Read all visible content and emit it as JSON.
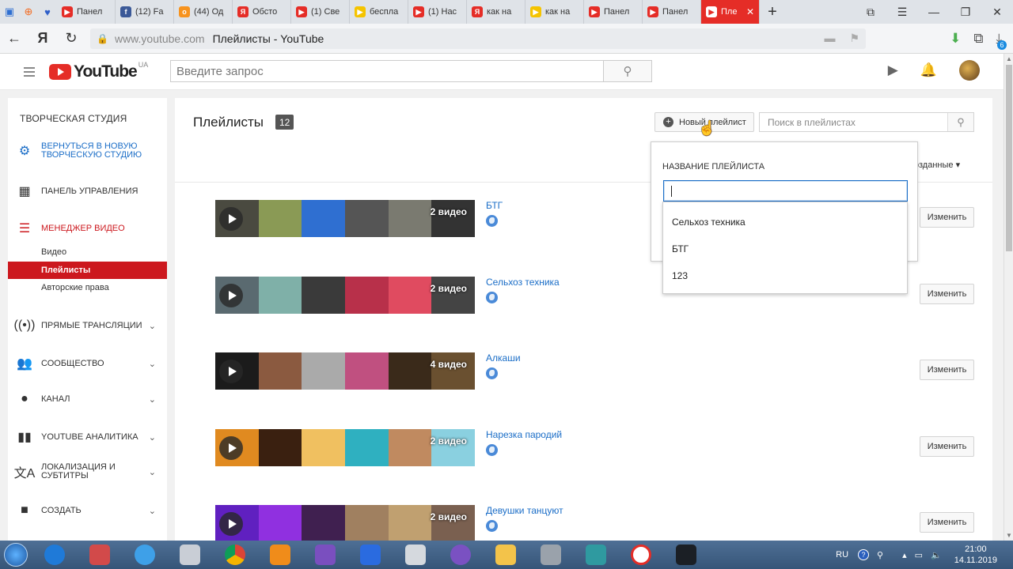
{
  "browser": {
    "tabs": [
      {
        "label": "",
        "icon": "pin-icon",
        "color": "#2f6fd1"
      },
      {
        "label": "",
        "icon": "plus-icon",
        "color": "#f36b21"
      },
      {
        "label": "",
        "icon": "heart-icon",
        "color": "#2f5fc9"
      },
      {
        "label": "Панел",
        "icon": "youtube-icon",
        "color": "#e52d27"
      },
      {
        "label": "(12) Fa",
        "icon": "facebook-icon",
        "color": "#3b5998"
      },
      {
        "label": "(44) Од",
        "icon": "odnoklassniki-icon",
        "color": "#f7931e"
      },
      {
        "label": "Обсто",
        "icon": "yandex-icon",
        "color": "#e52d27"
      },
      {
        "label": "(1) Све",
        "icon": "youtube-icon",
        "color": "#e52d27"
      },
      {
        "label": "беспла",
        "icon": "zen-icon",
        "color": "#f5c400"
      },
      {
        "label": "(1) Нас",
        "icon": "youtube-icon",
        "color": "#e52d27"
      },
      {
        "label": "как на",
        "icon": "yandex-icon",
        "color": "#e52d27"
      },
      {
        "label": "как на",
        "icon": "zen-icon",
        "color": "#f5c400"
      },
      {
        "label": "Панел",
        "icon": "youtube-icon",
        "color": "#e52d27"
      },
      {
        "label": "Панел",
        "icon": "youtube-icon",
        "color": "#e52d27"
      },
      {
        "label": "Пле",
        "icon": "youtube-icon",
        "color": "#ffffff",
        "active": true
      }
    ],
    "url_host": "www.youtube.com",
    "url_title": "Плейлисты - YouTube",
    "download_badge": "6"
  },
  "yt": {
    "logo_text": "YouTube",
    "region": "UA",
    "search_placeholder": "Введите запрос"
  },
  "sidebar": {
    "title": "ТВОРЧЕСКАЯ СТУДИЯ",
    "back": "ВЕРНУТЬСЯ В НОВУЮ ТВОРЧЕСКУЮ СТУДИЮ",
    "dashboard": "ПАНЕЛЬ УПРАВЛЕНИЯ",
    "video_manager": "МЕНЕДЖЕР ВИДЕО",
    "sub_video": "Видео",
    "sub_playlists": "Плейлисты",
    "sub_copyright": "Авторские права",
    "live": "ПРЯМЫЕ ТРАНСЛЯЦИИ",
    "community": "СООБЩЕСТВО",
    "channel": "КАНАЛ",
    "analytics": "YOUTUBE АНАЛИТИКА",
    "localization": "ЛОКАЛИЗАЦИЯ И СУБТИТРЫ",
    "create": "СОЗДАТЬ"
  },
  "main": {
    "title": "Плейлисты",
    "count": "12",
    "new_playlist": "Новый плейлист",
    "search_placeholder": "Поиск в плейлистах",
    "sort_label": "озданные",
    "edit_label": "Изменить",
    "playlists": [
      {
        "name": "БТГ",
        "videos": "2 видео"
      },
      {
        "name": "Сельхоз техника",
        "videos": "2 видео"
      },
      {
        "name": "Алкаши",
        "videos": "4 видео"
      },
      {
        "name": "Нарезка пародий",
        "videos": "2 видео"
      },
      {
        "name": "Девушки танцуют",
        "videos": "2 видео"
      }
    ]
  },
  "dropdown": {
    "label": "НАЗВАНИЕ ПЛЕЙЛИСТА",
    "input_value": "",
    "suggestions": [
      "Сельхоз техника",
      "БТГ",
      "123"
    ]
  },
  "taskbar": {
    "lang": "RU",
    "time": "21:00",
    "date": "14.11.2019"
  }
}
